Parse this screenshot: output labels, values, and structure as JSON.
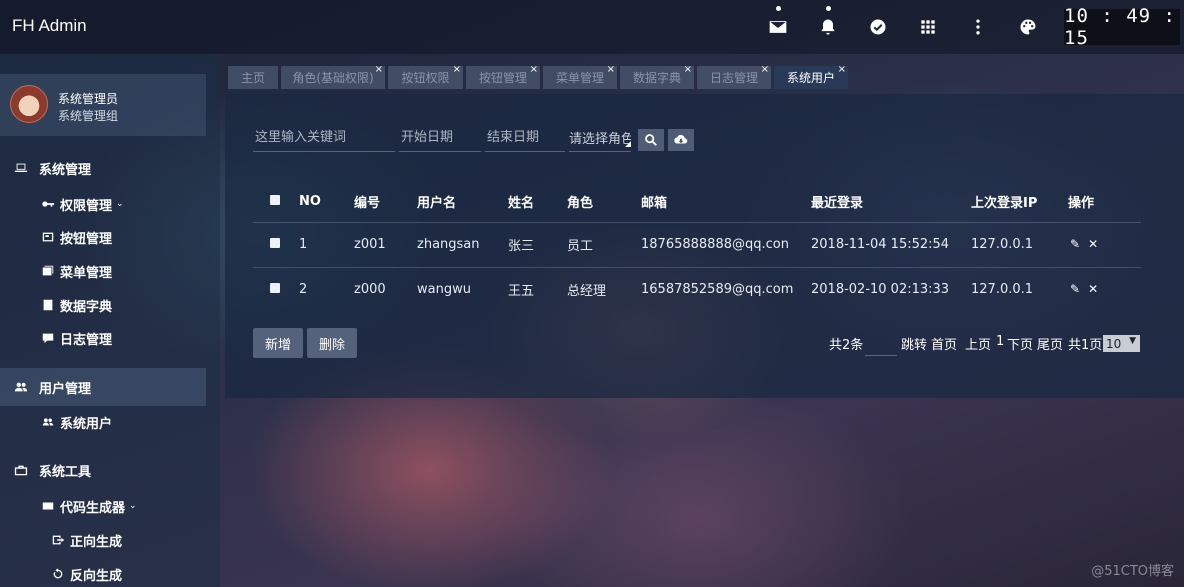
{
  "app": {
    "title": "FH Admin"
  },
  "header": {
    "clock": "10 : 49 : 15",
    "icons": [
      "mail-icon",
      "bell-icon",
      "check-circle-icon",
      "apps-grid-icon",
      "more-vert-icon",
      "palette-icon"
    ]
  },
  "user": {
    "name": "系统管理员",
    "group": "系统管理组"
  },
  "sidebar": {
    "items": [
      {
        "label": "系统管理",
        "icon": "laptop-icon"
      },
      {
        "label": "权限管理",
        "icon": "key-icon",
        "caret": "⌄"
      },
      {
        "label": "按钮管理",
        "icon": "button-box-icon"
      },
      {
        "label": "菜单管理",
        "icon": "menu-list-icon"
      },
      {
        "label": "数据字典",
        "icon": "book-icon"
      },
      {
        "label": "日志管理",
        "icon": "log-icon"
      },
      {
        "label": "用户管理",
        "icon": "people-icon"
      },
      {
        "label": "系统用户",
        "icon": "people-small-icon"
      },
      {
        "label": "系统工具",
        "icon": "toolbox-icon"
      },
      {
        "label": "代码生成器",
        "icon": "code-generator-icon",
        "caret": "⌄"
      },
      {
        "label": "正向生成",
        "icon": "forward-icon"
      },
      {
        "label": "反向生成",
        "icon": "reverse-icon"
      }
    ]
  },
  "tabs": [
    {
      "label": "主页"
    },
    {
      "label": "角色(基础权限)"
    },
    {
      "label": "按钮权限"
    },
    {
      "label": "按钮管理"
    },
    {
      "label": "菜单管理"
    },
    {
      "label": "数据字典"
    },
    {
      "label": "日志管理"
    },
    {
      "label": "系统用户"
    }
  ],
  "tab_close": "×",
  "search": {
    "keyword_placeholder": "这里输入关键词",
    "start_date_placeholder": "开始日期",
    "end_date_placeholder": "结束日期",
    "role_select": "请选择角色"
  },
  "table": {
    "headers": [
      "NO",
      "编号",
      "用户名",
      "姓名",
      "角色",
      "邮箱",
      "最近登录",
      "上次登录IP",
      "操作"
    ],
    "rows": [
      [
        "1",
        "z001",
        "zhangsan",
        "张三",
        "员工",
        "18765888888@qq.con",
        "2018-11-04 15:52:54",
        "127.0.0.1"
      ],
      [
        "2",
        "z000",
        "wangwu",
        "王五",
        "总经理",
        "16587852589@qq.com",
        "2018-02-10 02:13:33",
        "127.0.0.1"
      ]
    ],
    "edit_glyph": "✎",
    "delete_glyph": "✕"
  },
  "actions": {
    "add": "新增",
    "delete": "删除"
  },
  "pager": {
    "total": "共2条",
    "jump": "跳转",
    "first": "首页",
    "prev": "上页",
    "current": "1",
    "next": "下页",
    "last": "尾页",
    "pages": "共1页",
    "page_size": "10",
    "page_size_caret": "▼"
  },
  "watermark": "@51CTO博客"
}
